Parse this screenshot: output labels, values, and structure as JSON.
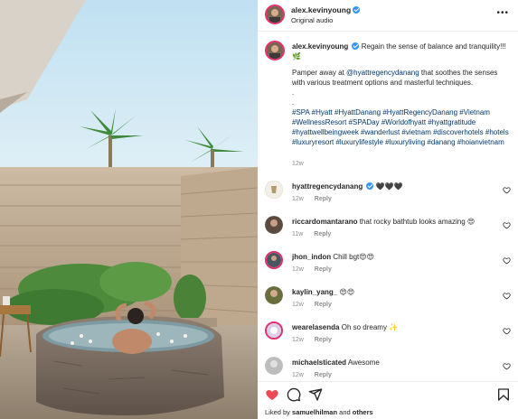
{
  "post": {
    "author": "alex.kevinyoung",
    "audio_label": "Original audio",
    "more_icon": "more-icon"
  },
  "caption": {
    "author": "alex.kevinyoung",
    "line1": "Regain the sense of balance and tranquility!!!",
    "emoji1": "🌿",
    "pamper_prefix": "Pamper away at",
    "mention": "@hyattregencydanang",
    "pamper_suffix": "that soothes the senses with various treatment options and masterful techniques.",
    "dot1": ".",
    "dot2": ".",
    "hashtags": "#SPA #Hyatt #HyattDanang #HyattRegencyDanang #Vietnam #WellnessResort #SPADay #Worldofhyatt #hyattgratitude #hyattwellbeingweek #wanderlust #vietnam #discoverhotels #hotels #luxuryresort #luxurylifestyle #luxuryliving #danang #hoianvietnam",
    "time": "12w"
  },
  "comments": [
    {
      "user": "hyattregencydanang",
      "verified": true,
      "text": "🖤🖤🖤",
      "time": "12w",
      "reply": "Reply",
      "avatar_color": "#f3efe6"
    },
    {
      "user": "riccardomantarano",
      "verified": false,
      "text": "that rocky bathtub looks amazing 😍",
      "time": "11w",
      "reply": "Reply",
      "avatar_color": "#5b4a40"
    },
    {
      "user": "jhon_indon",
      "verified": false,
      "text": "Chill bgt😍😍",
      "time": "12w",
      "reply": "Reply",
      "avatar_color": "#4a5560"
    },
    {
      "user": "kaylin_yang_",
      "verified": false,
      "text": "😍😍",
      "time": "12w",
      "reply": "Reply",
      "avatar_color": "#6a6d3e"
    },
    {
      "user": "wearelasenda",
      "verified": false,
      "text": "Oh so dreamy ✨",
      "time": "12w",
      "reply": "Reply",
      "avatar_color": "#d9cfe8"
    },
    {
      "user": "michaelsticated",
      "verified": false,
      "text": "Awesome",
      "time": "12w",
      "reply": "Reply",
      "avatar_color": "#bdbdbd"
    }
  ],
  "footer": {
    "liked_prefix": "Liked by",
    "liked_user": "samuelhilman",
    "liked_and": "and",
    "liked_others": "others",
    "icons": [
      "heart-icon",
      "comment-icon",
      "share-icon",
      "bookmark-icon"
    ],
    "heart_color": "#ed4956"
  }
}
